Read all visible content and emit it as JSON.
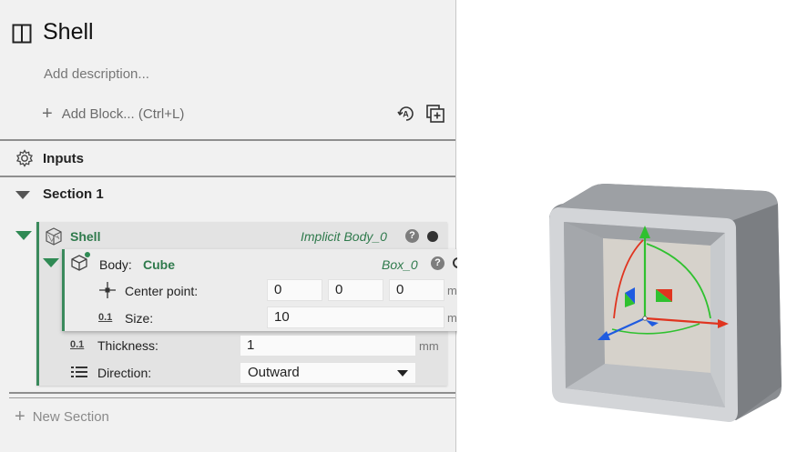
{
  "header": {
    "title": "Shell",
    "description_placeholder": "Add description...",
    "add_block_label": "Add Block... (Ctrl+L)"
  },
  "inputs": {
    "label": "Inputs"
  },
  "section": {
    "label": "Section 1"
  },
  "shell": {
    "name": "Shell",
    "reference": "Implicit Body_0",
    "body": {
      "label": "Body:",
      "value": "Cube",
      "reference": "Box_0",
      "center_point": {
        "label": "Center point:",
        "x": "0",
        "y": "0",
        "z": "0",
        "unit": "mm"
      },
      "size": {
        "label": "Size:",
        "value": "10",
        "unit": "mm"
      }
    },
    "thickness": {
      "label": "Thickness:",
      "value": "1",
      "unit": "mm"
    },
    "direction": {
      "label": "Direction:",
      "value": "Outward"
    },
    "number_icon": "0.1"
  },
  "new_section_label": "New Section",
  "colors": {
    "accent_green": "#2f7a4c",
    "axis_x": "#e0341f",
    "axis_y": "#2fc12f",
    "axis_z": "#1f5be0"
  },
  "icons": {
    "header": "panel-split-icon",
    "auto": "auto-icon",
    "copy": "duplicate-icon",
    "inputs": "gear-icon",
    "shell": "lattice-cube-icon",
    "body": "cube-icon",
    "center": "crosshair-icon",
    "direction": "list-icon"
  }
}
